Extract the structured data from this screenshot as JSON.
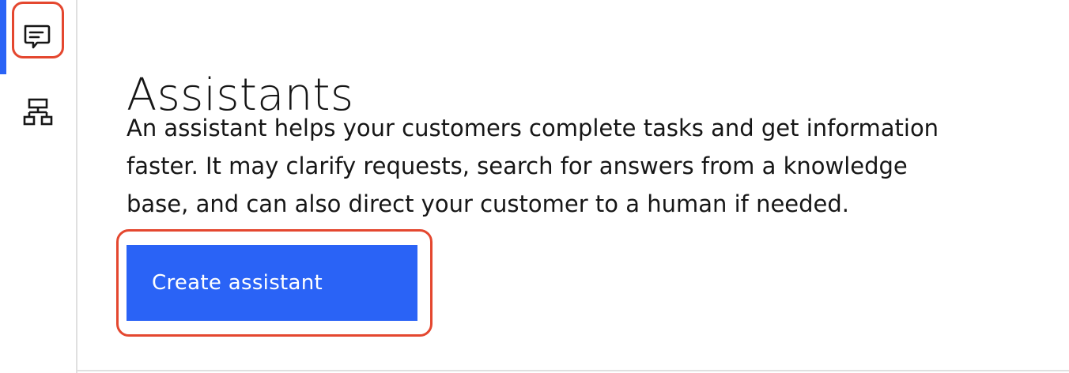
{
  "sidebar": {
    "items": [
      {
        "icon": "chat-bubble-icon",
        "active": true
      },
      {
        "icon": "flow-diagram-icon",
        "active": false
      }
    ]
  },
  "main": {
    "title": "Assistants",
    "description_lines": [
      "An assistant helps your customers complete tasks and get information",
      "faster. It may clarify requests, search for answers from a knowledge",
      "base, and can also direct your customer to a human if needed."
    ],
    "create_button_label": "Create assistant"
  },
  "colors": {
    "accent": "#2a63f6",
    "annotation": "#e4472f",
    "text": "#161616",
    "divider": "#e0e0e0"
  }
}
